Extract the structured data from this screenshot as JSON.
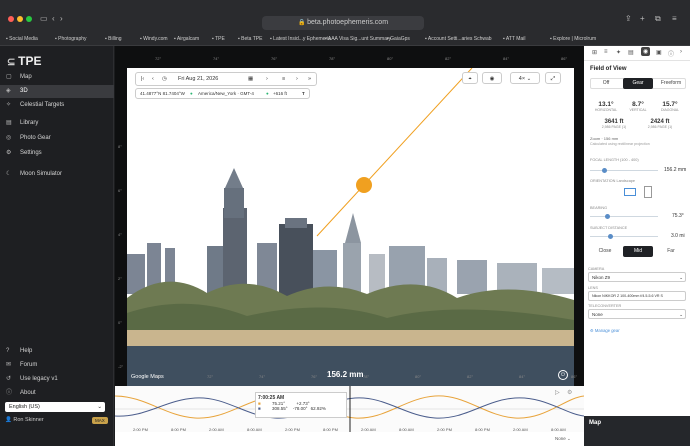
{
  "browser": {
    "url": "beta.photoephemeris.com",
    "bookmarks": [
      "Social Media",
      "Photography",
      "Billing",
      "Windy.com",
      "Airgalcam",
      "TPE",
      "Beta TPE",
      "Latest Insid...y Ephemeris",
      "AAA Visa Sig...unt Summary",
      "GaiaGps",
      "Account Setti...aries Schwab",
      "ATT Mail",
      "Explore | Microlrum"
    ]
  },
  "sidebar": {
    "logo": "TPE",
    "items": [
      {
        "label": "Map",
        "icon": "map-icon"
      },
      {
        "label": "3D",
        "icon": "cube-icon",
        "active": true
      },
      {
        "label": "Celestial Targets",
        "icon": "star-icon"
      },
      {
        "label": "Library",
        "icon": "book-icon"
      },
      {
        "label": "Photo Gear",
        "icon": "camera-icon"
      },
      {
        "label": "Settings",
        "icon": "gear-icon"
      },
      {
        "label": "Moon Simulator",
        "icon": "moon-icon"
      }
    ],
    "bottom": [
      {
        "label": "Help",
        "icon": "help-icon"
      },
      {
        "label": "Forum",
        "icon": "chat-icon"
      },
      {
        "label": "Use legacy v1",
        "icon": "legacy-icon"
      },
      {
        "label": "About",
        "icon": "info-icon"
      }
    ],
    "language": "English (US)",
    "user": "Ron Skinner",
    "badge": "MAX"
  },
  "map": {
    "date": "Fri Aug 21, 2026",
    "coords": "41.4877°N 81.7404°W",
    "timezone": "America/New_York · GMT-4",
    "elevation": "+616 ft",
    "zoom_opt": "4×",
    "focal_overlay": "156.2 mm",
    "google": "Google Maps",
    "top_ticks": [
      "72°",
      "74°",
      "76°",
      "78°",
      "80°",
      "82°",
      "84°",
      "86°"
    ],
    "bottom_ticks": [
      "70°",
      "72°",
      "74°",
      "76°",
      "78°",
      "80°",
      "82°",
      "84°",
      "86°"
    ],
    "left_ticks": [
      "8°",
      "6°",
      "4°",
      "2°",
      "0°",
      "-2°"
    ]
  },
  "timeline": {
    "time": "7:00:25 AM",
    "sun_az": "75.21°",
    "sun_alt": "+2.73°",
    "moon_az": "308.55°",
    "moon_alt": "-78.00°",
    "moon_illum": "62.92%",
    "times": [
      "2:00 PM",
      "8:00 PM",
      "2:00 AM",
      "8:00 AM",
      "2:00 PM",
      "8:00 PM",
      "2:00 AM",
      "8:00 AM",
      "2:00 PM",
      "8:00 PM",
      "2:00 AM",
      "8:00 AM"
    ],
    "range": "None"
  },
  "panel": {
    "title": "Field of View",
    "modes": [
      "Off",
      "Gear",
      "Freeform"
    ],
    "fov_h": "13.1°",
    "fov_v": "8.7°",
    "fov_d": "15.7°",
    "h_label": "HORIZONTAL",
    "v_label": "VERTICAL",
    "d_label": "DIAGONAL",
    "dist1": "3641 ft",
    "dist2": "2424 ft",
    "dist_sub": "2,986 PAGE (1)",
    "zoom_note": "Zoom · 156 mm",
    "calc_note": "Calculated using rectilinear projection",
    "focal_label": "FOCAL LENGTH",
    "focal_range": "(100 - 400)",
    "focal_value": "156.2 mm",
    "orient_label": "ORIENTATION",
    "orient_sub": "Landscape",
    "bearing_label": "BEARING",
    "bearing_value": "75.3°",
    "subject_label": "SUBJECT DISTANCE",
    "subject_value": "3.0 mi",
    "distance_opts": [
      "Close",
      "Mid",
      "Far"
    ],
    "camera_label": "CAMERA",
    "camera": "Nikon Z9",
    "lens_label": "LENS",
    "lens": "Nikon NIKKOR Z 100-400mm f/4.5-5.6 VR S",
    "tc_label": "TELECONVERTER",
    "tc": "None",
    "manage": "Manage gear",
    "map_title": "Map"
  }
}
